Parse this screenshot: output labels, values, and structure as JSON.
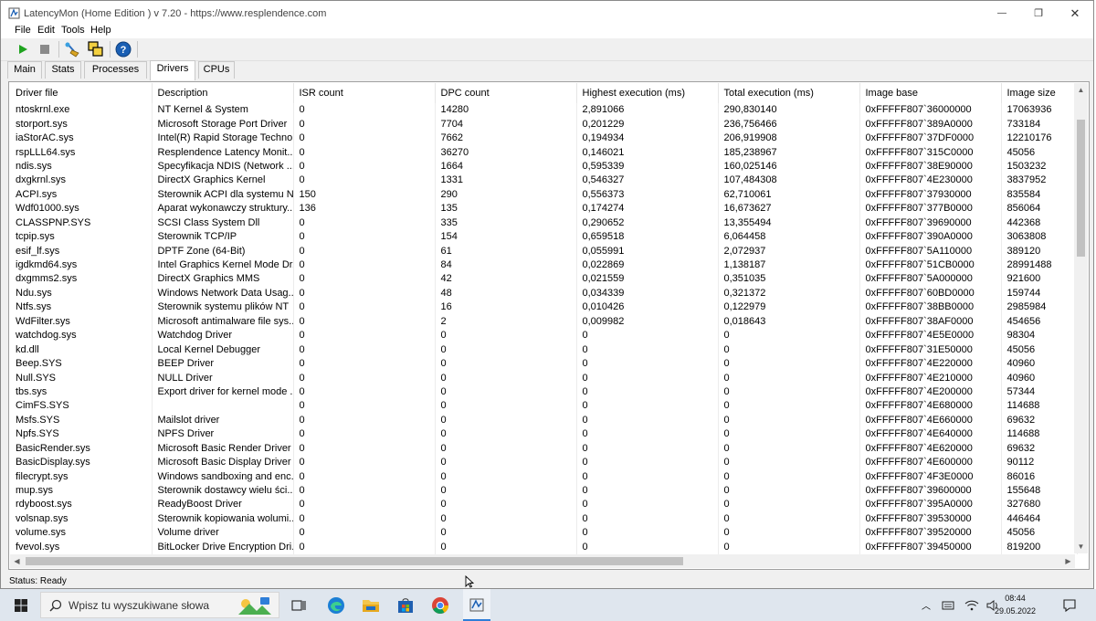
{
  "window": {
    "title": "LatencyMon  (Home Edition )  v 7.20 - https://www.resplendence.com",
    "minimize": "—",
    "maximize": "❐",
    "close": "✕"
  },
  "menu": [
    "File",
    "Edit",
    "Tools",
    "Help"
  ],
  "tabs": [
    {
      "label": "Main",
      "active": false
    },
    {
      "label": "Stats",
      "active": false
    },
    {
      "label": "Processes",
      "active": false
    },
    {
      "label": "Drivers",
      "active": true
    },
    {
      "label": "CPUs",
      "active": false
    }
  ],
  "table": {
    "columns": [
      "Driver file",
      "Description",
      "ISR count",
      "DPC count",
      "Highest execution (ms)",
      "Total execution (ms)",
      "Image base",
      "Image size"
    ],
    "rows": [
      [
        "ntoskrnl.exe",
        "NT Kernel & System",
        "0",
        "14280",
        "2,891066",
        "290,830140",
        "0xFFFFF807`36000000",
        "17063936"
      ],
      [
        "storport.sys",
        "Microsoft Storage Port Driver",
        "0",
        "7704",
        "0,201229",
        "236,756466",
        "0xFFFFF807`389A0000",
        "733184"
      ],
      [
        "iaStorAC.sys",
        "Intel(R) Rapid Storage Techno...",
        "0",
        "7662",
        "0,194934",
        "206,919908",
        "0xFFFFF807`37DF0000",
        "12210176"
      ],
      [
        "rspLLL64.sys",
        "Resplendence Latency Monit...",
        "0",
        "36270",
        "0,146021",
        "185,238967",
        "0xFFFFF807`315C0000",
        "45056"
      ],
      [
        "ndis.sys",
        "Specyfikacja NDIS (Network ...",
        "0",
        "1664",
        "0,595339",
        "160,025146",
        "0xFFFFF807`38E90000",
        "1503232"
      ],
      [
        "dxgkrnl.sys",
        "DirectX Graphics Kernel",
        "0",
        "1331",
        "0,546327",
        "107,484308",
        "0xFFFFF807`4E230000",
        "3837952"
      ],
      [
        "ACPI.sys",
        "Sterownik ACPI dla systemu NT",
        "150",
        "290",
        "0,556373",
        "62,710061",
        "0xFFFFF807`37930000",
        "835584"
      ],
      [
        "Wdf01000.sys",
        "Aparat wykonawczy struktury...",
        "136",
        "135",
        "0,174274",
        "16,673627",
        "0xFFFFF807`377B0000",
        "856064"
      ],
      [
        "CLASSPNP.SYS",
        "SCSI Class System Dll",
        "0",
        "335",
        "0,290652",
        "13,355494",
        "0xFFFFF807`39690000",
        "442368"
      ],
      [
        "tcpip.sys",
        "Sterownik TCP/IP",
        "0",
        "154",
        "0,659518",
        "6,064458",
        "0xFFFFF807`390A0000",
        "3063808"
      ],
      [
        "esif_lf.sys",
        "DPTF Zone (64-Bit)",
        "0",
        "61",
        "0,055991",
        "2,072937",
        "0xFFFFF807`5A110000",
        "389120"
      ],
      [
        "igdkmd64.sys",
        "Intel Graphics Kernel Mode Dr...",
        "0",
        "84",
        "0,022869",
        "1,138187",
        "0xFFFFF807`51CB0000",
        "28991488"
      ],
      [
        "dxgmms2.sys",
        "DirectX Graphics MMS",
        "0",
        "42",
        "0,021559",
        "0,351035",
        "0xFFFFF807`5A000000",
        "921600"
      ],
      [
        "Ndu.sys",
        "Windows Network Data Usag...",
        "0",
        "48",
        "0,034339",
        "0,321372",
        "0xFFFFF807`60BD0000",
        "159744"
      ],
      [
        "Ntfs.sys",
        "Sterownik systemu plików NT",
        "0",
        "16",
        "0,010426",
        "0,122979",
        "0xFFFFF807`38BB0000",
        "2985984"
      ],
      [
        "WdFilter.sys",
        "Microsoft antimalware file sys...",
        "0",
        "2",
        "0,009982",
        "0,018643",
        "0xFFFFF807`38AF0000",
        "454656"
      ],
      [
        "watchdog.sys",
        "Watchdog Driver",
        "0",
        "0",
        "0",
        "0",
        "0xFFFFF807`4E5E0000",
        "98304"
      ],
      [
        "kd.dll",
        "Local Kernel Debugger",
        "0",
        "0",
        "0",
        "0",
        "0xFFFFF807`31E50000",
        "45056"
      ],
      [
        "Beep.SYS",
        "BEEP Driver",
        "0",
        "0",
        "0",
        "0",
        "0xFFFFF807`4E220000",
        "40960"
      ],
      [
        "Null.SYS",
        "NULL Driver",
        "0",
        "0",
        "0",
        "0",
        "0xFFFFF807`4E210000",
        "40960"
      ],
      [
        "tbs.sys",
        "Export driver for kernel mode ...",
        "0",
        "0",
        "0",
        "0",
        "0xFFFFF807`4E200000",
        "57344"
      ],
      [
        "CimFS.SYS",
        "",
        "0",
        "0",
        "0",
        "0",
        "0xFFFFF807`4E680000",
        "114688"
      ],
      [
        "Msfs.SYS",
        "Mailslot driver",
        "0",
        "0",
        "0",
        "0",
        "0xFFFFF807`4E660000",
        "69632"
      ],
      [
        "Npfs.SYS",
        "NPFS Driver",
        "0",
        "0",
        "0",
        "0",
        "0xFFFFF807`4E640000",
        "114688"
      ],
      [
        "BasicRender.sys",
        "Microsoft Basic Render Driver",
        "0",
        "0",
        "0",
        "0",
        "0xFFFFF807`4E620000",
        "69632"
      ],
      [
        "BasicDisplay.sys",
        "Microsoft Basic Display Driver",
        "0",
        "0",
        "0",
        "0",
        "0xFFFFF807`4E600000",
        "90112"
      ],
      [
        "filecrypt.sys",
        "Windows sandboxing and enc...",
        "0",
        "0",
        "0",
        "0",
        "0xFFFFF807`4F3E0000",
        "86016"
      ],
      [
        "mup.sys",
        "Sterownik dostawcy wielu ści...",
        "0",
        "0",
        "0",
        "0",
        "0xFFFFF807`39600000",
        "155648"
      ],
      [
        "rdyboost.sys",
        "ReadyBoost Driver",
        "0",
        "0",
        "0",
        "0",
        "0xFFFFF807`395A0000",
        "327680"
      ],
      [
        "volsnap.sys",
        "Sterownik kopiowania wolumi...",
        "0",
        "0",
        "0",
        "0",
        "0xFFFFF807`39530000",
        "446464"
      ],
      [
        "volume.sys",
        "Volume driver",
        "0",
        "0",
        "0",
        "0",
        "0xFFFFF807`39520000",
        "45056"
      ],
      [
        "fvevol.sys",
        "BitLocker Drive Encryption Dri...",
        "0",
        "0",
        "0",
        "0",
        "0xFFFFF807`39450000",
        "819200"
      ]
    ]
  },
  "status": "Status: Ready",
  "taskbar": {
    "search_placeholder": "Wpisz tu wyszukiwane słowa",
    "time": "08:44",
    "date": "29.05.2022"
  },
  "colors": {
    "play": "#1fa31f",
    "help": "#1a5fb4",
    "taskbar": "#dfe6ee"
  }
}
